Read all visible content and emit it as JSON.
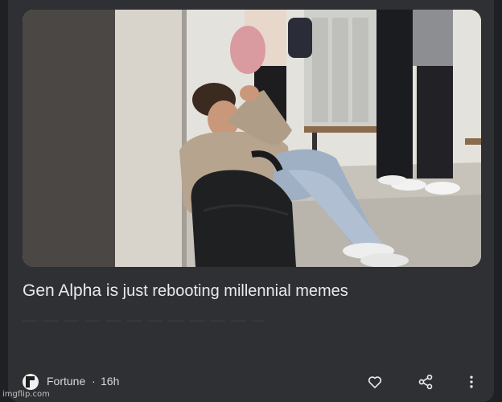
{
  "article": {
    "headline_part_a": "Gen Alpha is",
    "headline_part_b": "just rebooting millennial memes",
    "source": "Fortune",
    "separator": "·",
    "age": "16h",
    "image_icon": "news-photo-teen-sitting-in-hallway"
  },
  "actions": {
    "like_icon": "heart-outline-icon",
    "share_icon": "share-icon",
    "more_icon": "more-vertical-icon"
  },
  "watermark": "imgflip.com",
  "colors": {
    "background": "#1f2023",
    "card": "#2f3034",
    "text": "#e8eaed",
    "muted": "#d6d8db"
  }
}
